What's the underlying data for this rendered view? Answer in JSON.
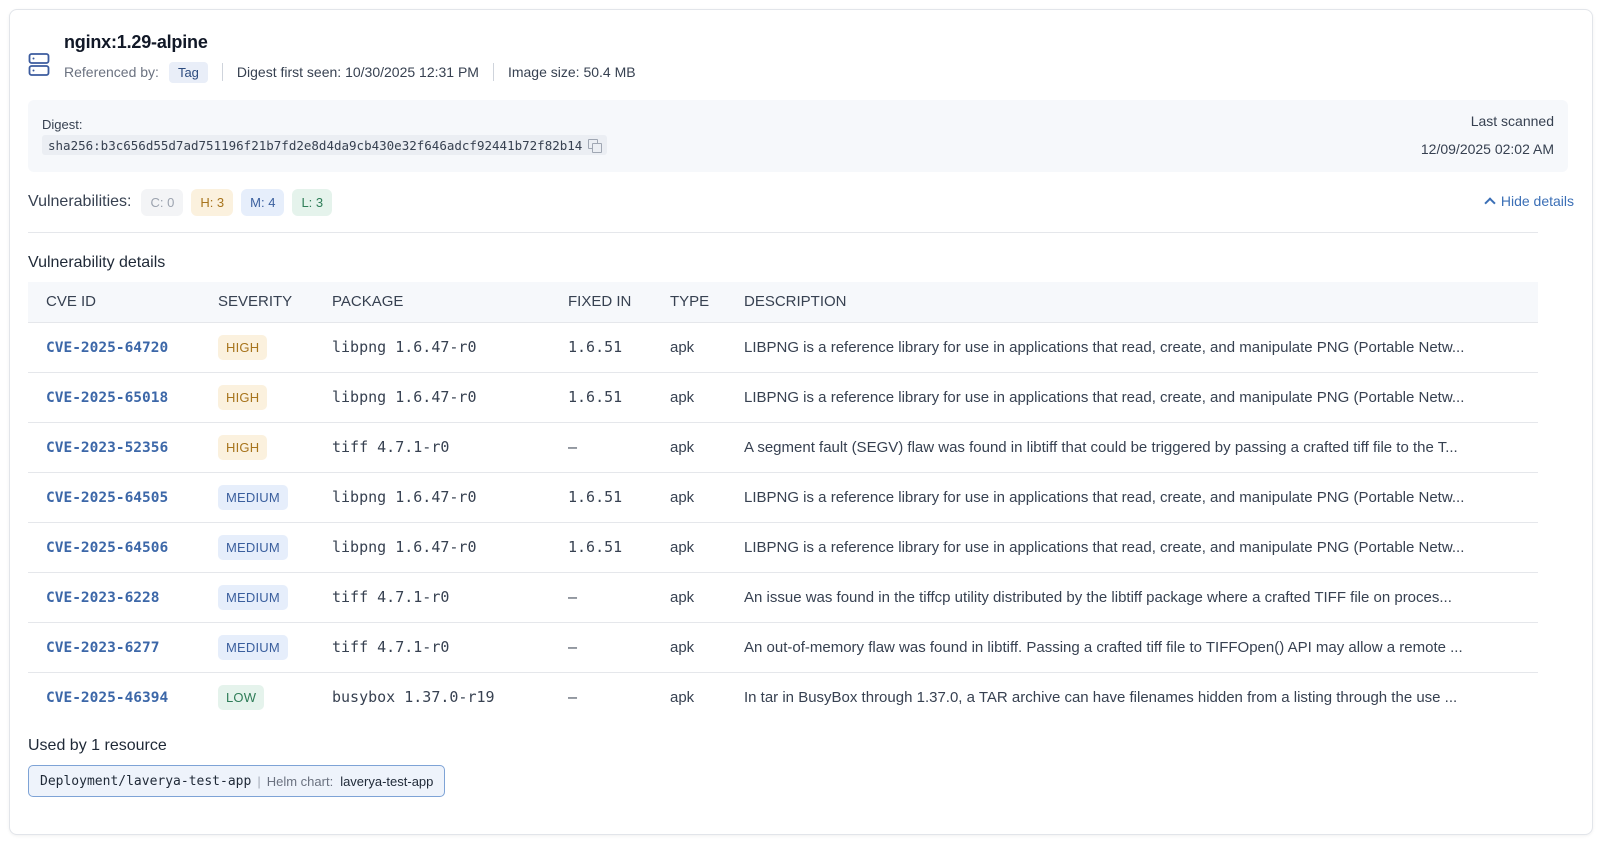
{
  "image": {
    "title": "nginx:1.29-alpine",
    "referenced_by_label": "Referenced by:",
    "referenced_by_tag": "Tag",
    "digest_first_seen": "Digest first seen: 10/30/2025 12:31 PM",
    "image_size": "Image size: 50.4 MB",
    "icon": "server-icon"
  },
  "digest": {
    "label": "Digest:",
    "value": "sha256:b3c656d55d7ad751196f21b7fd2e8d4da9cb430e32f646adcf92441b72f82b14",
    "last_scanned_label": "Last scanned",
    "last_scanned_value": "12/09/2025 02:02 AM"
  },
  "vulnerabilities": {
    "label": "Vulnerabilities:",
    "critical": "C: 0",
    "high": "H: 3",
    "medium": "M: 4",
    "low": "L: 3",
    "hide_details": "Hide details"
  },
  "details": {
    "title": "Vulnerability details",
    "columns": [
      "CVE ID",
      "SEVERITY",
      "PACKAGE",
      "FIXED IN",
      "TYPE",
      "DESCRIPTION"
    ],
    "rows": [
      {
        "cve": "CVE-2025-64720",
        "severity": "HIGH",
        "package": "libpng 1.6.47-r0",
        "fixed": "1.6.51",
        "type": "apk",
        "description": "LIBPNG is a reference library for use in applications that read, create, and manipulate PNG (Portable Netw..."
      },
      {
        "cve": "CVE-2025-65018",
        "severity": "HIGH",
        "package": "libpng 1.6.47-r0",
        "fixed": "1.6.51",
        "type": "apk",
        "description": "LIBPNG is a reference library for use in applications that read, create, and manipulate PNG (Portable Netw..."
      },
      {
        "cve": "CVE-2023-52356",
        "severity": "HIGH",
        "package": "tiff 4.7.1-r0",
        "fixed": "–",
        "type": "apk",
        "description": "A segment fault (SEGV) flaw was found in libtiff that could be triggered by passing a crafted tiff file to the T..."
      },
      {
        "cve": "CVE-2025-64505",
        "severity": "MEDIUM",
        "package": "libpng 1.6.47-r0",
        "fixed": "1.6.51",
        "type": "apk",
        "description": "LIBPNG is a reference library for use in applications that read, create, and manipulate PNG (Portable Netw..."
      },
      {
        "cve": "CVE-2025-64506",
        "severity": "MEDIUM",
        "package": "libpng 1.6.47-r0",
        "fixed": "1.6.51",
        "type": "apk",
        "description": "LIBPNG is a reference library for use in applications that read, create, and manipulate PNG (Portable Netw..."
      },
      {
        "cve": "CVE-2023-6228",
        "severity": "MEDIUM",
        "package": "tiff 4.7.1-r0",
        "fixed": "–",
        "type": "apk",
        "description": "An issue was found in the tiffcp utility distributed by the libtiff package where a crafted TIFF file on proces..."
      },
      {
        "cve": "CVE-2023-6277",
        "severity": "MEDIUM",
        "package": "tiff 4.7.1-r0",
        "fixed": "–",
        "type": "apk",
        "description": "An out-of-memory flaw was found in libtiff. Passing a crafted tiff file to TIFFOpen() API may allow a remote ..."
      },
      {
        "cve": "CVE-2025-46394",
        "severity": "LOW",
        "package": "busybox 1.37.0-r19",
        "fixed": "–",
        "type": "apk",
        "description": "In tar in BusyBox through 1.37.0, a TAR archive can have filenames hidden from a listing through the use ..."
      }
    ]
  },
  "used_by": {
    "title": "Used by 1 resource",
    "resource": "Deployment/laverya-test-app",
    "helm_label": "Helm chart:",
    "helm_value": "laverya-test-app"
  }
}
